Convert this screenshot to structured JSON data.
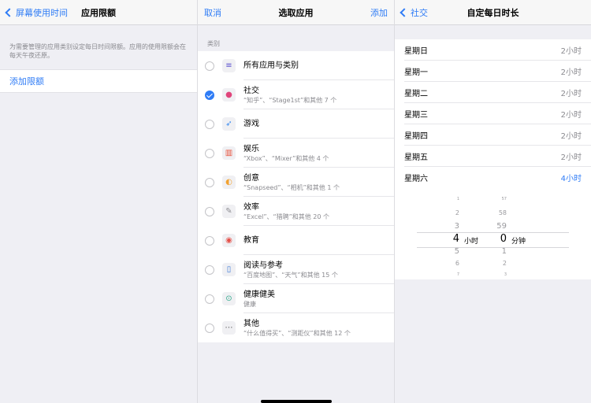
{
  "screen1": {
    "back_label": "屏幕使用时间",
    "title": "应用限额",
    "description": "为需要管理的应用类别设定每日时间限额。应用的使用限额会在每天午夜还原。",
    "add_limit": "添加限额"
  },
  "screen2": {
    "cancel": "取消",
    "title": "选取应用",
    "add": "添加",
    "section_header": "类别",
    "items": [
      {
        "name": "所有应用与类别",
        "sub": "",
        "checked": false,
        "icon": "stack-icon",
        "color": "#5a4fcf"
      },
      {
        "name": "社交",
        "sub": "“知乎”、“Stage1st”和其他 7 个",
        "checked": true,
        "icon": "chat-bubble-icon",
        "color": "#e0457b"
      },
      {
        "name": "游戏",
        "sub": "",
        "checked": false,
        "icon": "rocket-icon",
        "color": "#3b8cf0"
      },
      {
        "name": "娱乐",
        "sub": "“Xbox”、“Mixer”和其他 4 个",
        "checked": false,
        "icon": "popcorn-icon",
        "color": "#e8503a"
      },
      {
        "name": "创意",
        "sub": "“Snapseed”、“相机”和其他 1 个",
        "checked": false,
        "icon": "palette-icon",
        "color": "#f2a230"
      },
      {
        "name": "效率",
        "sub": "“Excel”、“猎聘”和其他 20 个",
        "checked": false,
        "icon": "pen-icon",
        "color": "#8e8e93"
      },
      {
        "name": "教育",
        "sub": "",
        "checked": false,
        "icon": "globe-icon",
        "color": "#e5514a"
      },
      {
        "name": "阅读与参考",
        "sub": "“百度地图”、“天气”和其他 15 个",
        "checked": false,
        "icon": "book-icon",
        "color": "#3d7ad6"
      },
      {
        "name": "健康健美",
        "sub": "健康",
        "checked": false,
        "icon": "bicycle-icon",
        "color": "#2fa88a"
      },
      {
        "name": "其他",
        "sub": "“什么值得买”、“测距仪”和其他 12 个",
        "checked": false,
        "icon": "more-dots-icon",
        "color": "#555555"
      }
    ]
  },
  "screen3": {
    "back_label": "社交",
    "title": "自定每日时长",
    "days": [
      {
        "day": "星期日",
        "value": "2小时",
        "active": false
      },
      {
        "day": "星期一",
        "value": "2小时",
        "active": false
      },
      {
        "day": "星期二",
        "value": "2小时",
        "active": false
      },
      {
        "day": "星期三",
        "value": "2小时",
        "active": false
      },
      {
        "day": "星期四",
        "value": "2小时",
        "active": false
      },
      {
        "day": "星期五",
        "value": "2小时",
        "active": false
      },
      {
        "day": "星期六",
        "value": "4小时",
        "active": true
      }
    ],
    "picker": {
      "hours_above": [
        "1",
        "2",
        "3"
      ],
      "hours_selected": "4",
      "hours_below": [
        "5",
        "6",
        "7"
      ],
      "hours_unit": "小时",
      "minutes_above": [
        "57",
        "58",
        "59"
      ],
      "minutes_selected": "0",
      "minutes_below": [
        "1",
        "2",
        "3"
      ],
      "minutes_unit": "分钟"
    }
  }
}
